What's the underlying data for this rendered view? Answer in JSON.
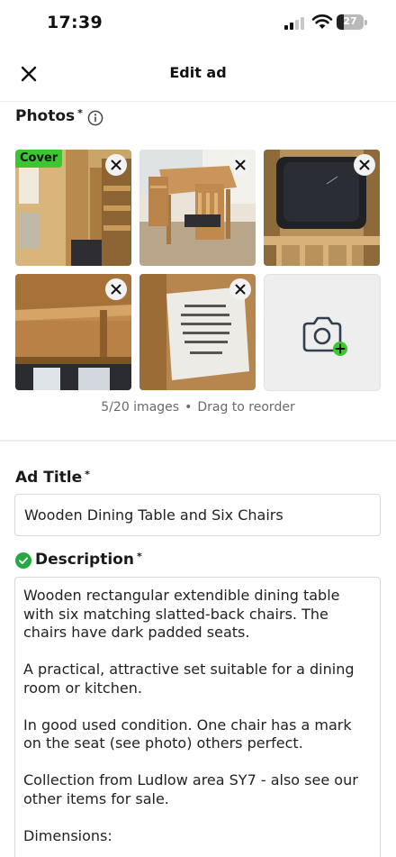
{
  "status_bar": {
    "time": "17:39",
    "battery": "27",
    "battery_level_percent": 27,
    "signal_bars_active": 2,
    "signal_bars_total": 4
  },
  "header": {
    "title": "Edit ad",
    "close_icon": "close-icon"
  },
  "photos": {
    "label": "Photos",
    "required_mark": "*",
    "info_icon": "info-icon",
    "cover_badge": "Cover",
    "count_text": "5/20 images",
    "separator": "•",
    "hint": "Drag to reorder",
    "items": [
      {
        "name": "photo-1",
        "subject": "table-top-and-chair-legs"
      },
      {
        "name": "photo-2",
        "subject": "dining-table-set"
      },
      {
        "name": "photo-3",
        "subject": "dark-chair-seat"
      },
      {
        "name": "photo-4",
        "subject": "table-underside"
      },
      {
        "name": "photo-5",
        "subject": "label-paper"
      }
    ],
    "add_photo_icon": "camera-plus-icon"
  },
  "ad_title": {
    "label": "Ad Title",
    "required_mark": "*",
    "value": "Wooden Dining Table and Six Chairs"
  },
  "description": {
    "label": "Description",
    "required_mark": "*",
    "status_icon": "check-circle-icon",
    "paragraphs": [
      "Wooden rectangular extendible dining table with six matching slatted-back chairs. The chairs have dark padded seats.",
      "A practical, attractive set suitable for a dining room or kitchen.",
      "In good used condition. One chair has a mark on the seat (see photo) others perfect.",
      "Collection from Ludlow area SY7 - also see our other items for sale.",
      "Dimensions:"
    ]
  },
  "colors": {
    "accent_green": "#3cc630",
    "check_green": "#27a844",
    "text": "#222222",
    "muted": "#6a6a6a"
  }
}
